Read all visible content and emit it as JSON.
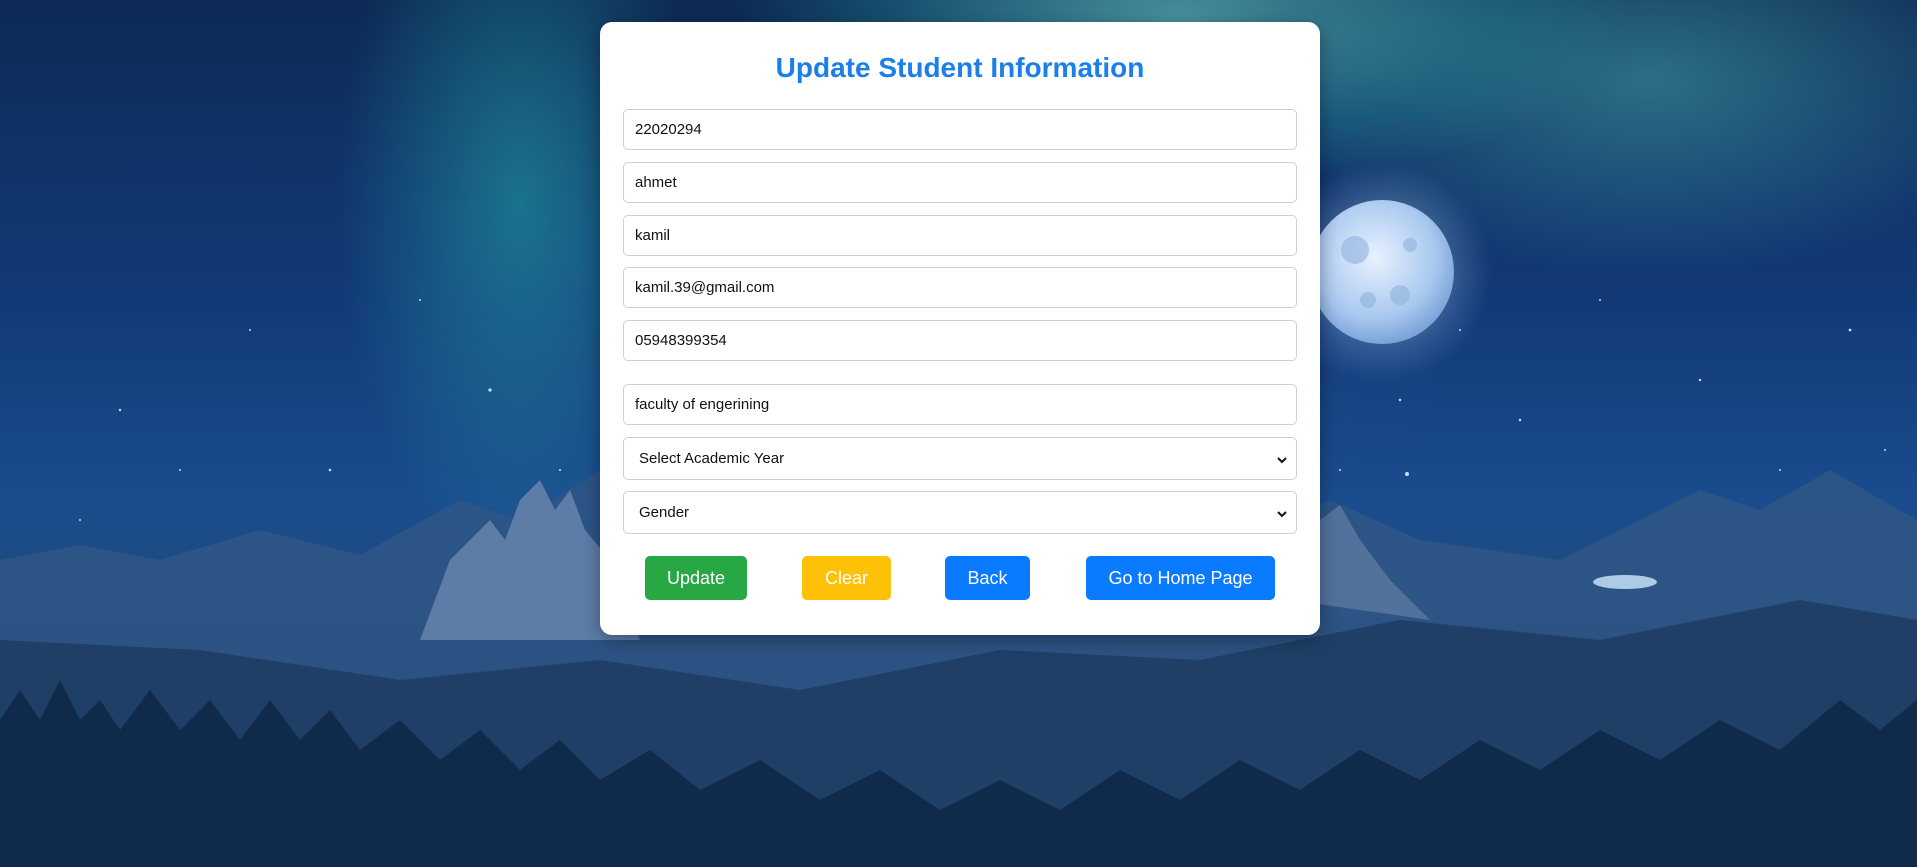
{
  "form": {
    "title": "Update Student Information",
    "student_id": "22020294",
    "first_name": "ahmet",
    "last_name": "kamil",
    "email": "kamil.39@gmail.com",
    "phone": "05948399354",
    "faculty": "faculty of engerining",
    "academic_year_select": "Select Academic Year",
    "gender_select": "Gender"
  },
  "buttons": {
    "update": "Update",
    "clear": "Clear",
    "back": "Back",
    "home": "Go to Home Page"
  },
  "colors": {
    "title": "#1a7fe8",
    "update": "#28a745",
    "clear": "#ffc107",
    "back": "#0a7bff",
    "home": "#0a7bff"
  },
  "icons": {
    "dropdown": "chevron-down-icon"
  }
}
